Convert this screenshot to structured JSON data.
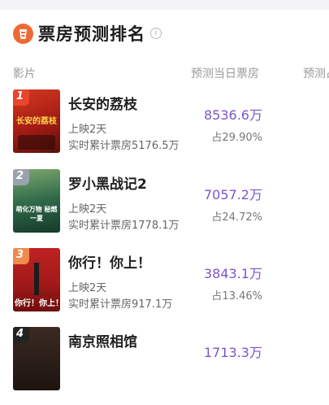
{
  "header": {
    "title": "票房预测排名",
    "info_icon": "i"
  },
  "columns": {
    "film": "影片",
    "forecast": "预测当日票房",
    "extra": "预测占"
  },
  "movies": [
    {
      "rank": "1",
      "name": "长安的荔枝",
      "days": "上映2天",
      "cumulative": "实时累计票房5176.5万",
      "forecast": "8536.6万",
      "share": "占29.90%",
      "poster_text": "长安的荔枝",
      "badge_color": "#e8452c",
      "poster_color": "#b8261c"
    },
    {
      "rank": "2",
      "name": "罗小黑战记2",
      "days": "上映2天",
      "cumulative": "实时累计票房1778.1万",
      "forecast": "7057.2万",
      "share": "占24.72%",
      "poster_text": "萌化万物 秘燃一夏",
      "badge_color": "#9aa3ad",
      "poster_color": "#2f6a4a"
    },
    {
      "rank": "3",
      "name": "你行！你上！",
      "days": "上映2天",
      "cumulative": "实时累计票房917.1万",
      "forecast": "3843.1万",
      "share": "占13.46%",
      "poster_text": "你行！你上！",
      "badge_color": "#f08a4b",
      "poster_color": "#b01d1d"
    },
    {
      "rank": "4",
      "name": "南京照相馆",
      "forecast": "1713.3万",
      "badge_color": "#222222",
      "poster_color": "#3a2a22"
    }
  ]
}
